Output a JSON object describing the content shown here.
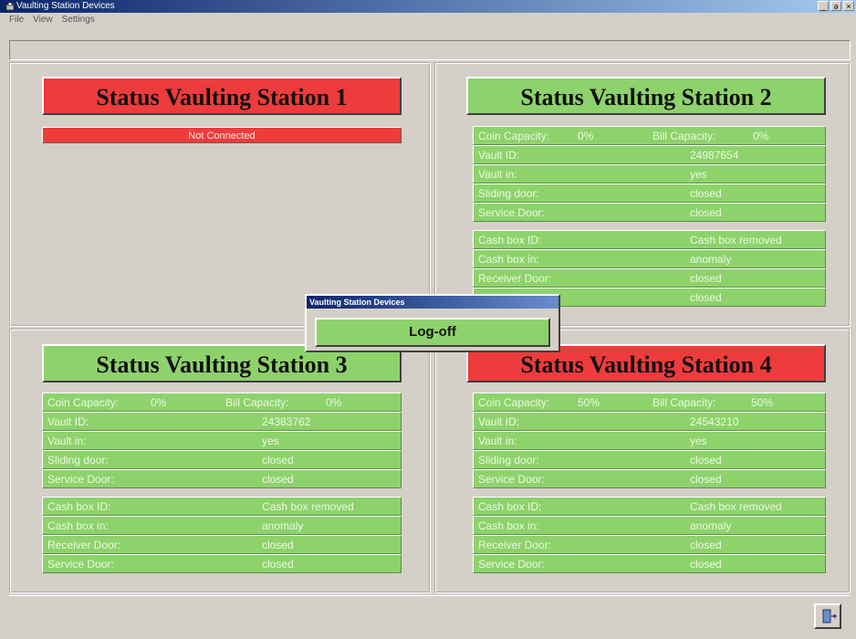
{
  "window": {
    "title": "Vaulting Station Devices",
    "minimize": "_",
    "restore": "ə",
    "close": "×"
  },
  "menu": [
    "File",
    "View",
    "Settings"
  ],
  "icons": {
    "app": "app-icon",
    "exit": "exit-door-icon"
  },
  "colors": {
    "status_ok": "#8ed26c",
    "status_error": "#ee3b3b"
  },
  "stations": {
    "s1": {
      "title": "Status Vaulting Station 1",
      "state": "Not Connected"
    },
    "s2": {
      "title": "Status Vaulting Station 2",
      "coin_label": "Coin Capacity:",
      "coin_value": "0%",
      "bill_label": "Bill Capacity:",
      "bill_value": "0%",
      "vault_id_label": "Vault ID:",
      "vault_id": "24987654",
      "vault_in_label": "Vault in:",
      "vault_in": "yes",
      "sliding_door_label": "Sliding door:",
      "sliding_door": "closed",
      "service_door_label": "Service Door:",
      "service_door": "closed",
      "cash_box_id_label": "Cash box ID:",
      "cash_box_id": "Cash box removed",
      "cash_box_in_label": "Cash box in:",
      "cash_box_in": "anomaly",
      "receiver_door_label": "Receiver Door:",
      "receiver_door": "closed",
      "service_door_2": "closed"
    },
    "s3": {
      "title": "Status Vaulting Station 3",
      "coin_label": "Coin Capacity:",
      "coin_value": "0%",
      "bill_label": "Bill Capacity:",
      "bill_value": "0%",
      "vault_id_label": "Vault ID:",
      "vault_id": "24383762",
      "vault_in_label": "Vault in:",
      "vault_in": "yes",
      "sliding_door_label": "Sliding door:",
      "sliding_door": "closed",
      "service_door_label": "Service Door:",
      "service_door": "closed",
      "cash_box_id_label": "Cash box ID:",
      "cash_box_id": "Cash box removed",
      "cash_box_in_label": "Cash box in:",
      "cash_box_in": "anomaly",
      "receiver_door_label": "Receiver Door:",
      "receiver_door": "closed",
      "service_door_2_label": "Service Door:",
      "service_door_2": "closed"
    },
    "s4": {
      "title": "Status Vaulting Station 4",
      "coin_label": "Coin Capacity:",
      "coin_value": "50%",
      "bill_label": "Bill Capacity:",
      "bill_value": "50%",
      "vault_id_label": "Vault ID:",
      "vault_id": "24543210",
      "vault_in_label": "Vault in:",
      "vault_in": "yes",
      "sliding_door_label": "Sliding door:",
      "sliding_door": "closed",
      "service_door_label": "Service Door:",
      "service_door": "closed",
      "cash_box_id_label": "Cash box ID:",
      "cash_box_id": "Cash box removed",
      "cash_box_in_label": "Cash box in:",
      "cash_box_in": "anomaly",
      "receiver_door_label": "Receiver Door:",
      "receiver_door": "closed",
      "service_door_2_label": "Service Door:",
      "service_door_2": "closed"
    }
  },
  "dialog": {
    "title": "Vaulting Station Devices",
    "button": "Log-off"
  }
}
